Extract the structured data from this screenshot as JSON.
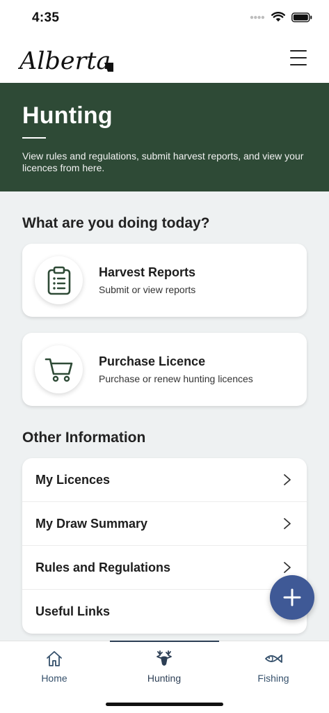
{
  "status_bar": {
    "time": "4:35"
  },
  "header": {
    "logo_text": "Alberta",
    "menu_icon": "hamburger-icon"
  },
  "hero": {
    "title": "Hunting",
    "description": "View rules and regulations, submit harvest reports, and view your licences from here."
  },
  "today": {
    "heading": "What are you doing today?",
    "cards": [
      {
        "title": "Harvest Reports",
        "subtitle": "Submit or view reports",
        "icon": "clipboard-icon"
      },
      {
        "title": "Purchase Licence",
        "subtitle": "Purchase or renew hunting licences",
        "icon": "cart-icon"
      }
    ]
  },
  "other": {
    "heading": "Other Information",
    "items": [
      {
        "label": "My Licences"
      },
      {
        "label": "My Draw Summary"
      },
      {
        "label": "Rules and Regulations"
      },
      {
        "label": "Useful Links"
      }
    ]
  },
  "fab": {
    "icon": "plus-icon"
  },
  "tabs": [
    {
      "label": "Home",
      "icon": "home-icon",
      "active": false
    },
    {
      "label": "Hunting",
      "icon": "deer-icon",
      "active": true
    },
    {
      "label": "Fishing",
      "icon": "fish-icon",
      "active": false
    }
  ],
  "colors": {
    "hero_bg": "#2e4a36",
    "page_bg": "#eef1f2",
    "fab_bg": "#3f5996",
    "tab_label": "#35506b"
  }
}
